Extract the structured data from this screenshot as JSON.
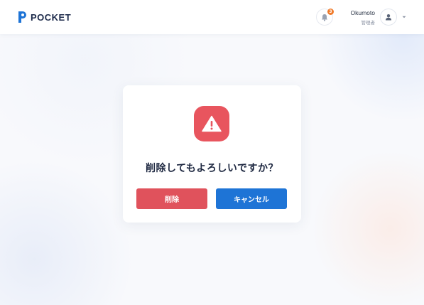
{
  "header": {
    "brand": "POCKET",
    "notification_count": "3",
    "user": {
      "name": "Okumoto",
      "role": "管理者"
    }
  },
  "dialog": {
    "question": "削除してもよろしいですか？",
    "delete_label": "削除",
    "cancel_label": "キャンセル"
  },
  "colors": {
    "brand": "#1e74d6",
    "danger": "#e0525c",
    "badge": "#f07a2a"
  },
  "icons": [
    "logo-icon",
    "bell-icon",
    "user-icon",
    "chevron-down-icon",
    "warning-icon"
  ]
}
